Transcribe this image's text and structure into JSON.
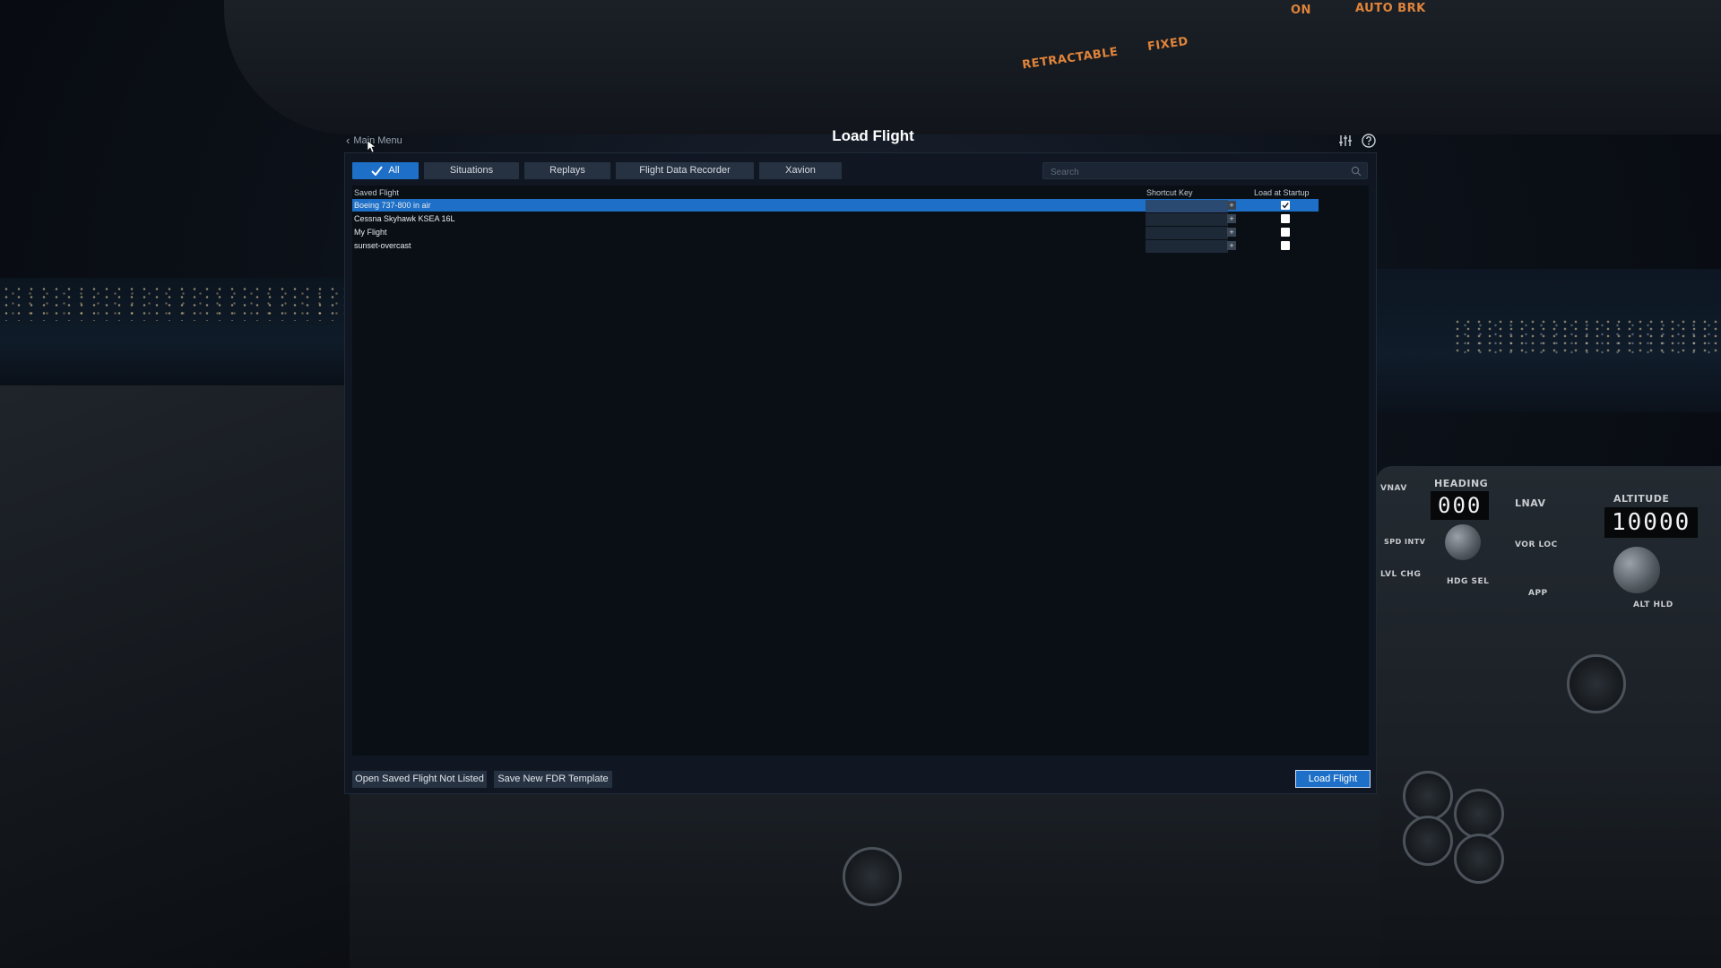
{
  "header": {
    "back_label": "Main Menu",
    "title": "Load Flight",
    "icons": [
      "sliders-icon",
      "help-icon"
    ]
  },
  "tabs": [
    {
      "label": "All",
      "active": true
    },
    {
      "label": "Situations",
      "active": false
    },
    {
      "label": "Replays",
      "active": false
    },
    {
      "label": "Flight Data Recorder",
      "active": false
    },
    {
      "label": "Xavion",
      "active": false
    }
  ],
  "search": {
    "placeholder": "Search",
    "value": ""
  },
  "table": {
    "columns": {
      "saved_flight": "Saved Flight",
      "shortcut_key": "Shortcut Key",
      "load_at_startup": "Load at Startup"
    },
    "rows": [
      {
        "name": "Boeing 737-800 in air",
        "shortcut": "",
        "load_at_startup": true,
        "selected": true
      },
      {
        "name": "Cessna Skyhawk KSEA 16L",
        "shortcut": "",
        "load_at_startup": false,
        "selected": false
      },
      {
        "name": "My Flight",
        "shortcut": "",
        "load_at_startup": false,
        "selected": false
      },
      {
        "name": "sunset-overcast",
        "shortcut": "",
        "load_at_startup": false,
        "selected": false
      }
    ],
    "plus_label": "+"
  },
  "footer": {
    "open_saved": "Open Saved Flight Not Listed",
    "save_fdr": "Save New FDR Template",
    "load_flight": "Load Flight"
  },
  "background": {
    "labels": {
      "retractable": "RETRACTABLE",
      "fixed": "FIXED",
      "on": "ON",
      "auto": "AUTO BRK",
      "heading": "HEADING",
      "altitude": "ALTITUDE",
      "lnav": "LNAV",
      "vor_loc": "VOR LOC",
      "hdg_sel": "HDG SEL",
      "app": "APP",
      "alt_hld": "ALT HLD",
      "lvl_chg": "LVL CHG",
      "vnav": "VNAV",
      "spd_intv": "SPD INTV"
    },
    "heading_value": "000",
    "altitude_value": "10000"
  },
  "colors": {
    "accent": "#1d6fc7",
    "panel": "#101722",
    "tab": "#263241"
  }
}
